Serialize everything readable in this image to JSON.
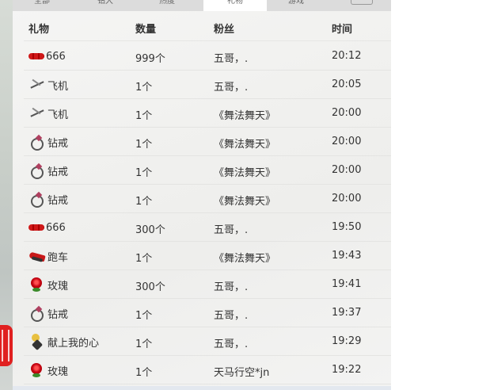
{
  "tabs": [
    {
      "label": "全部",
      "active": false
    },
    {
      "label": "钻大",
      "active": false
    },
    {
      "label": "热度",
      "active": false
    },
    {
      "label": "礼物",
      "active": true
    },
    {
      "label": "游戏",
      "active": false
    }
  ],
  "table": {
    "columns": [
      "礼物",
      "数量",
      "粉丝",
      "时间"
    ],
    "rows": [
      {
        "icon": "combo-666-icon",
        "gift": "666",
        "qty": "999个",
        "fan": "五哥，.",
        "time": "20:12"
      },
      {
        "icon": "airplane-icon",
        "gift": "飞机",
        "qty": "1个",
        "fan": "五哥，.",
        "time": "20:05"
      },
      {
        "icon": "airplane-icon",
        "gift": "飞机",
        "qty": "1个",
        "fan": "《舞法舞天》",
        "time": "20:00"
      },
      {
        "icon": "diamond-ring-icon",
        "gift": "钻戒",
        "qty": "1个",
        "fan": "《舞法舞天》",
        "time": "20:00"
      },
      {
        "icon": "diamond-ring-icon",
        "gift": "钻戒",
        "qty": "1个",
        "fan": "《舞法舞天》",
        "time": "20:00"
      },
      {
        "icon": "diamond-ring-icon",
        "gift": "钻戒",
        "qty": "1个",
        "fan": "《舞法舞天》",
        "time": "20:00"
      },
      {
        "icon": "combo-666-icon",
        "gift": "666",
        "qty": "300个",
        "fan": "五哥，.",
        "time": "19:50"
      },
      {
        "icon": "sports-car-icon",
        "gift": "跑车",
        "qty": "1个",
        "fan": "《舞法舞天》",
        "time": "19:43"
      },
      {
        "icon": "rose-icon",
        "gift": "玫瑰",
        "qty": "300个",
        "fan": "五哥，.",
        "time": "19:41"
      },
      {
        "icon": "diamond-ring-icon",
        "gift": "钻戒",
        "qty": "1个",
        "fan": "五哥，.",
        "time": "19:37"
      },
      {
        "icon": "heart-offering-icon",
        "gift": "献上我的心",
        "qty": "1个",
        "fan": "五哥，.",
        "time": "19:29"
      },
      {
        "icon": "rose-icon",
        "gift": "玫瑰",
        "qty": "1个",
        "fan": "天马行空*jn",
        "time": "19:22"
      }
    ]
  }
}
